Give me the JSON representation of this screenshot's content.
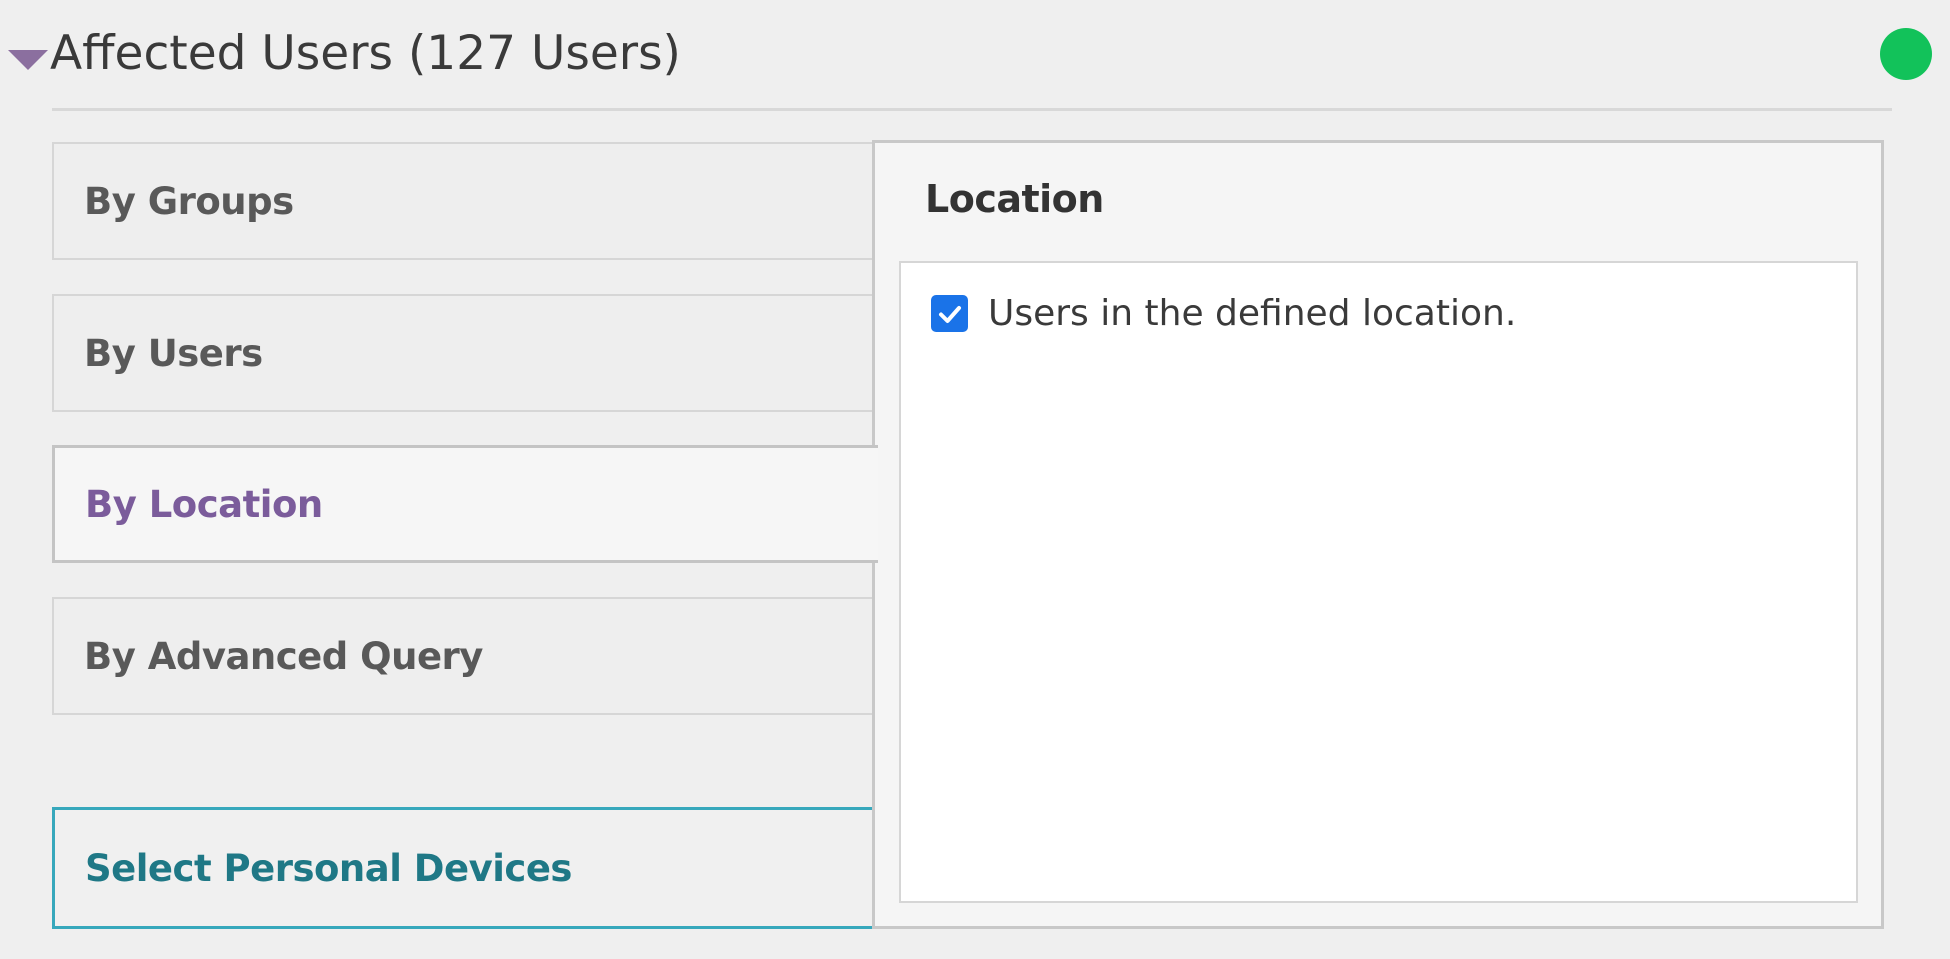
{
  "section": {
    "title": "Affected Users (127 Users)",
    "status_color": "#12c25a",
    "caret_icon": "caret-down-icon"
  },
  "tabs": [
    {
      "label": "By Groups",
      "state": "default"
    },
    {
      "label": "By Users",
      "state": "default"
    },
    {
      "label": "By Location",
      "state": "active"
    },
    {
      "label": "By Advanced Query",
      "state": "default"
    }
  ],
  "select_devices": {
    "label": "Select Personal Devices"
  },
  "panel": {
    "title": "Location",
    "checkbox": {
      "label": "Users in the defined location.",
      "checked": true
    }
  },
  "colors": {
    "accent_purple": "#7b5c9b",
    "accent_teal": "#1f7886",
    "checkbox_blue": "#1a73e8"
  }
}
